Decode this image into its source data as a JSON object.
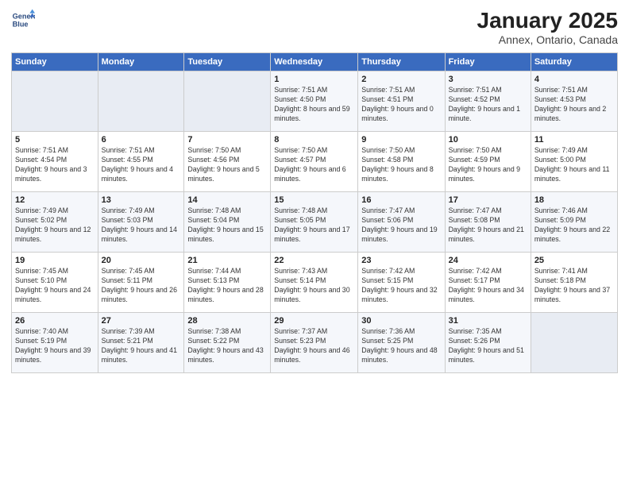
{
  "header": {
    "logo_line1": "General",
    "logo_line2": "Blue",
    "month": "January 2025",
    "location": "Annex, Ontario, Canada"
  },
  "weekdays": [
    "Sunday",
    "Monday",
    "Tuesday",
    "Wednesday",
    "Thursday",
    "Friday",
    "Saturday"
  ],
  "weeks": [
    [
      {
        "day": "",
        "empty": true
      },
      {
        "day": "",
        "empty": true
      },
      {
        "day": "",
        "empty": true
      },
      {
        "day": "1",
        "sunrise": "7:51 AM",
        "sunset": "4:50 PM",
        "daylight": "8 hours and 59 minutes."
      },
      {
        "day": "2",
        "sunrise": "7:51 AM",
        "sunset": "4:51 PM",
        "daylight": "9 hours and 0 minutes."
      },
      {
        "day": "3",
        "sunrise": "7:51 AM",
        "sunset": "4:52 PM",
        "daylight": "9 hours and 1 minute."
      },
      {
        "day": "4",
        "sunrise": "7:51 AM",
        "sunset": "4:53 PM",
        "daylight": "9 hours and 2 minutes."
      }
    ],
    [
      {
        "day": "5",
        "sunrise": "7:51 AM",
        "sunset": "4:54 PM",
        "daylight": "9 hours and 3 minutes."
      },
      {
        "day": "6",
        "sunrise": "7:51 AM",
        "sunset": "4:55 PM",
        "daylight": "9 hours and 4 minutes."
      },
      {
        "day": "7",
        "sunrise": "7:50 AM",
        "sunset": "4:56 PM",
        "daylight": "9 hours and 5 minutes."
      },
      {
        "day": "8",
        "sunrise": "7:50 AM",
        "sunset": "4:57 PM",
        "daylight": "9 hours and 6 minutes."
      },
      {
        "day": "9",
        "sunrise": "7:50 AM",
        "sunset": "4:58 PM",
        "daylight": "9 hours and 8 minutes."
      },
      {
        "day": "10",
        "sunrise": "7:50 AM",
        "sunset": "4:59 PM",
        "daylight": "9 hours and 9 minutes."
      },
      {
        "day": "11",
        "sunrise": "7:49 AM",
        "sunset": "5:00 PM",
        "daylight": "9 hours and 11 minutes."
      }
    ],
    [
      {
        "day": "12",
        "sunrise": "7:49 AM",
        "sunset": "5:02 PM",
        "daylight": "9 hours and 12 minutes."
      },
      {
        "day": "13",
        "sunrise": "7:49 AM",
        "sunset": "5:03 PM",
        "daylight": "9 hours and 14 minutes."
      },
      {
        "day": "14",
        "sunrise": "7:48 AM",
        "sunset": "5:04 PM",
        "daylight": "9 hours and 15 minutes."
      },
      {
        "day": "15",
        "sunrise": "7:48 AM",
        "sunset": "5:05 PM",
        "daylight": "9 hours and 17 minutes."
      },
      {
        "day": "16",
        "sunrise": "7:47 AM",
        "sunset": "5:06 PM",
        "daylight": "9 hours and 19 minutes."
      },
      {
        "day": "17",
        "sunrise": "7:47 AM",
        "sunset": "5:08 PM",
        "daylight": "9 hours and 21 minutes."
      },
      {
        "day": "18",
        "sunrise": "7:46 AM",
        "sunset": "5:09 PM",
        "daylight": "9 hours and 22 minutes."
      }
    ],
    [
      {
        "day": "19",
        "sunrise": "7:45 AM",
        "sunset": "5:10 PM",
        "daylight": "9 hours and 24 minutes."
      },
      {
        "day": "20",
        "sunrise": "7:45 AM",
        "sunset": "5:11 PM",
        "daylight": "9 hours and 26 minutes."
      },
      {
        "day": "21",
        "sunrise": "7:44 AM",
        "sunset": "5:13 PM",
        "daylight": "9 hours and 28 minutes."
      },
      {
        "day": "22",
        "sunrise": "7:43 AM",
        "sunset": "5:14 PM",
        "daylight": "9 hours and 30 minutes."
      },
      {
        "day": "23",
        "sunrise": "7:42 AM",
        "sunset": "5:15 PM",
        "daylight": "9 hours and 32 minutes."
      },
      {
        "day": "24",
        "sunrise": "7:42 AM",
        "sunset": "5:17 PM",
        "daylight": "9 hours and 34 minutes."
      },
      {
        "day": "25",
        "sunrise": "7:41 AM",
        "sunset": "5:18 PM",
        "daylight": "9 hours and 37 minutes."
      }
    ],
    [
      {
        "day": "26",
        "sunrise": "7:40 AM",
        "sunset": "5:19 PM",
        "daylight": "9 hours and 39 minutes."
      },
      {
        "day": "27",
        "sunrise": "7:39 AM",
        "sunset": "5:21 PM",
        "daylight": "9 hours and 41 minutes."
      },
      {
        "day": "28",
        "sunrise": "7:38 AM",
        "sunset": "5:22 PM",
        "daylight": "9 hours and 43 minutes."
      },
      {
        "day": "29",
        "sunrise": "7:37 AM",
        "sunset": "5:23 PM",
        "daylight": "9 hours and 46 minutes."
      },
      {
        "day": "30",
        "sunrise": "7:36 AM",
        "sunset": "5:25 PM",
        "daylight": "9 hours and 48 minutes."
      },
      {
        "day": "31",
        "sunrise": "7:35 AM",
        "sunset": "5:26 PM",
        "daylight": "9 hours and 51 minutes."
      },
      {
        "day": "",
        "empty": true
      }
    ]
  ],
  "labels": {
    "sunrise": "Sunrise:",
    "sunset": "Sunset:",
    "daylight": "Daylight:"
  }
}
